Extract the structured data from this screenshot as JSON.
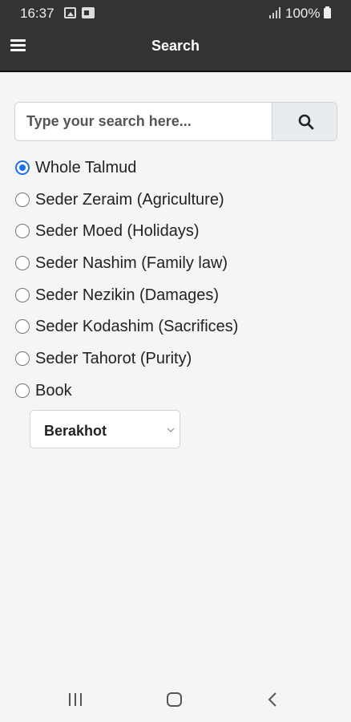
{
  "status_bar": {
    "time": "16:37",
    "battery": "100%",
    "icons": [
      "gallery-icon",
      "photo-icon",
      "signal-icon",
      "battery-icon"
    ]
  },
  "header": {
    "title": "Search",
    "menu_icon": "hamburger-menu-icon"
  },
  "search": {
    "placeholder": "Type your search here...",
    "value": "",
    "button_icon": "search-icon"
  },
  "options": [
    {
      "label": "Whole Talmud",
      "checked": true
    },
    {
      "label": "Seder Zeraim (Agriculture)",
      "checked": false
    },
    {
      "label": "Seder Moed (Holidays)",
      "checked": false
    },
    {
      "label": "Seder Nashim (Family law)",
      "checked": false
    },
    {
      "label": "Seder Nezikin (Damages)",
      "checked": false
    },
    {
      "label": "Seder Kodashim (Sacrifices)",
      "checked": false
    },
    {
      "label": "Seder Tahorot (Purity)",
      "checked": false
    },
    {
      "label": "Book",
      "checked": false
    }
  ],
  "book_select": {
    "selected": "Berakhot"
  },
  "colors": {
    "header_bg": "#333333",
    "accent": "#1a73e8",
    "page_bg": "#f5f5f5"
  },
  "nav_bar": {
    "icons": [
      "recent-apps-icon",
      "home-icon",
      "back-icon"
    ]
  }
}
